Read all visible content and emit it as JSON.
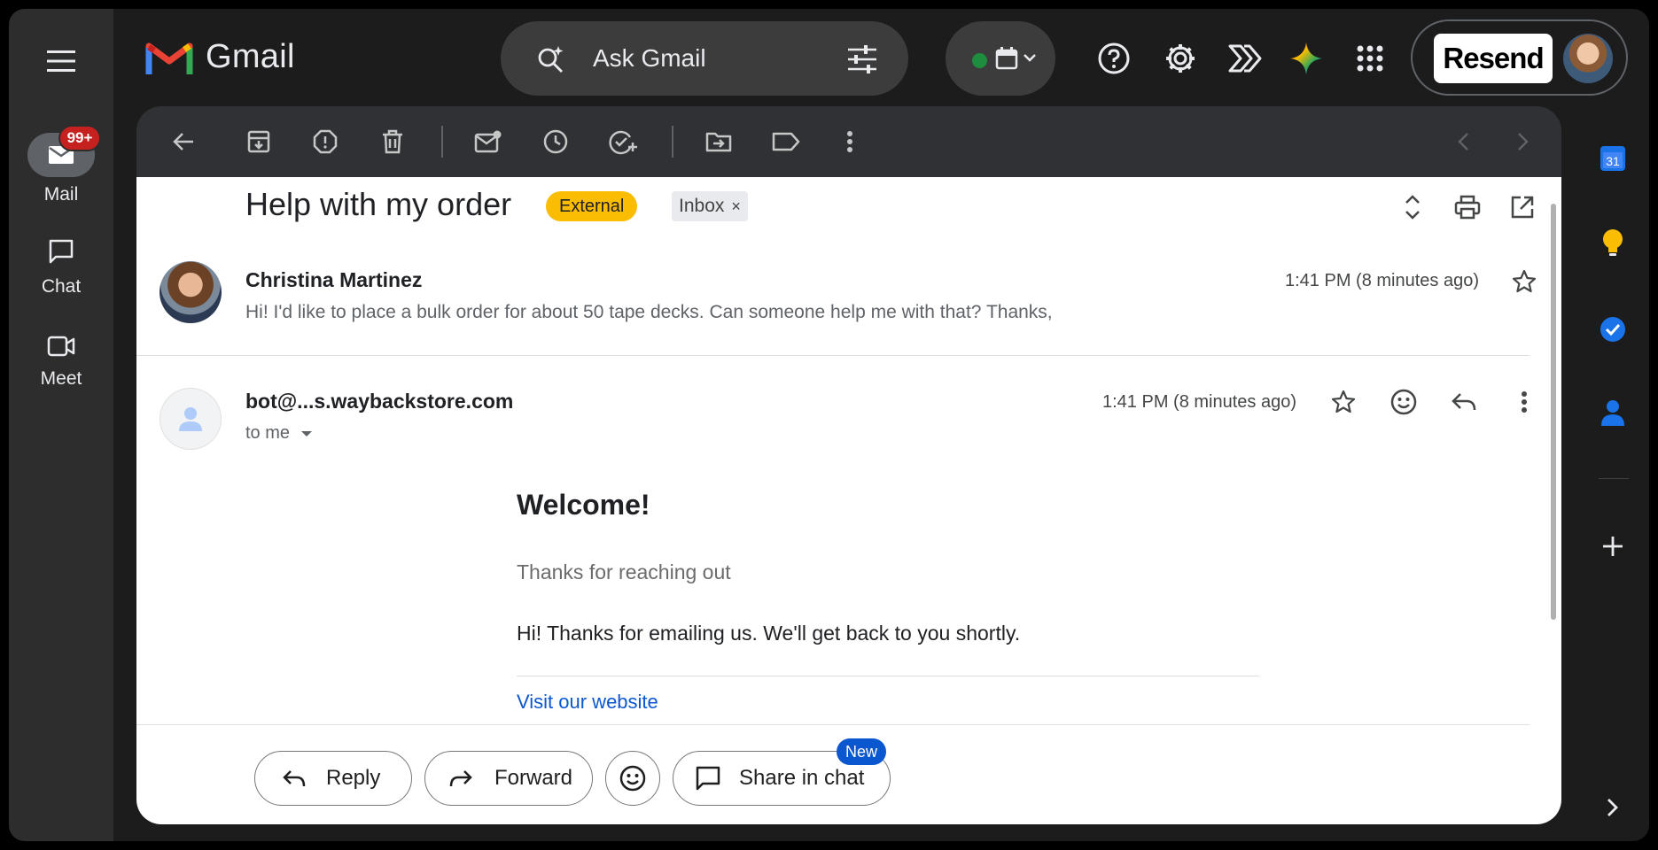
{
  "app": {
    "name": "Gmail"
  },
  "search": {
    "placeholder": "Ask Gmail"
  },
  "account": {
    "brand": "Resend"
  },
  "leftnav": {
    "mail_label": "Mail",
    "mail_badge": "99+",
    "chat_label": "Chat",
    "meet_label": "Meet"
  },
  "email": {
    "subject": "Help with my order",
    "labels": {
      "external": "External",
      "inbox": "Inbox",
      "remove": "×"
    },
    "messages": [
      {
        "sender": "Christina Martinez",
        "time": "1:41 PM (8 minutes ago)",
        "snippet": "Hi! I'd like to place a bulk order for about 50 tape decks. Can someone help me with that? Thanks,"
      },
      {
        "sender": "bot@...s.waybackstore.com",
        "time": "1:41 PM (8 minutes ago)",
        "recipient": "to me",
        "body": {
          "heading": "Welcome!",
          "preheader": "Thanks for reaching out",
          "text": "Hi! Thanks for emailing us. We'll get back to you shortly.",
          "link": "Visit our website"
        }
      }
    ]
  },
  "actions": {
    "reply": "Reply",
    "forward": "Forward",
    "share": "Share in chat",
    "new_badge": "New"
  },
  "rail": {
    "calendar_day": "31"
  },
  "colors": {
    "gmail_red": "#ea4335",
    "external_chip": "#fbbc04",
    "link": "#0b57d0",
    "status_online": "#1e8e3e",
    "badge": "#c5221f"
  }
}
